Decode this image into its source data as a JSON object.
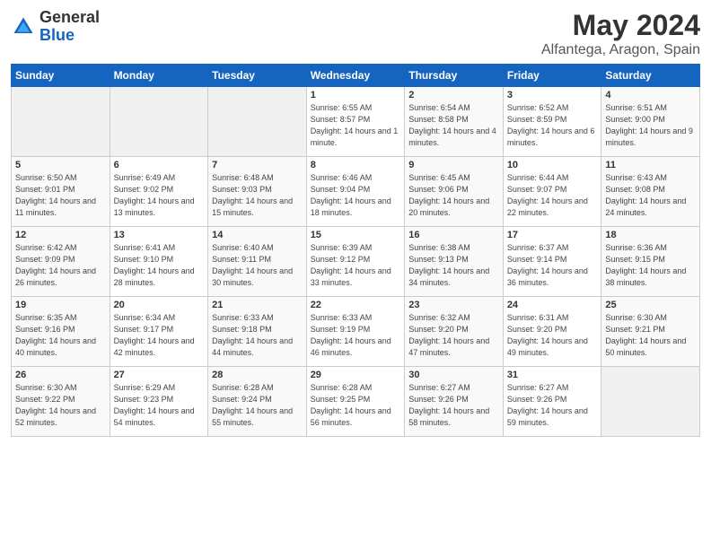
{
  "logo": {
    "general": "General",
    "blue": "Blue"
  },
  "header": {
    "month": "May 2024",
    "location": "Alfantega, Aragon, Spain"
  },
  "days_of_week": [
    "Sunday",
    "Monday",
    "Tuesday",
    "Wednesday",
    "Thursday",
    "Friday",
    "Saturday"
  ],
  "weeks": [
    [
      {
        "day": "",
        "sunrise": "",
        "sunset": "",
        "daylight": "",
        "empty": true
      },
      {
        "day": "",
        "sunrise": "",
        "sunset": "",
        "daylight": "",
        "empty": true
      },
      {
        "day": "",
        "sunrise": "",
        "sunset": "",
        "daylight": "",
        "empty": true
      },
      {
        "day": "1",
        "sunrise": "Sunrise: 6:55 AM",
        "sunset": "Sunset: 8:57 PM",
        "daylight": "Daylight: 14 hours and 1 minute."
      },
      {
        "day": "2",
        "sunrise": "Sunrise: 6:54 AM",
        "sunset": "Sunset: 8:58 PM",
        "daylight": "Daylight: 14 hours and 4 minutes."
      },
      {
        "day": "3",
        "sunrise": "Sunrise: 6:52 AM",
        "sunset": "Sunset: 8:59 PM",
        "daylight": "Daylight: 14 hours and 6 minutes."
      },
      {
        "day": "4",
        "sunrise": "Sunrise: 6:51 AM",
        "sunset": "Sunset: 9:00 PM",
        "daylight": "Daylight: 14 hours and 9 minutes."
      }
    ],
    [
      {
        "day": "5",
        "sunrise": "Sunrise: 6:50 AM",
        "sunset": "Sunset: 9:01 PM",
        "daylight": "Daylight: 14 hours and 11 minutes."
      },
      {
        "day": "6",
        "sunrise": "Sunrise: 6:49 AM",
        "sunset": "Sunset: 9:02 PM",
        "daylight": "Daylight: 14 hours and 13 minutes."
      },
      {
        "day": "7",
        "sunrise": "Sunrise: 6:48 AM",
        "sunset": "Sunset: 9:03 PM",
        "daylight": "Daylight: 14 hours and 15 minutes."
      },
      {
        "day": "8",
        "sunrise": "Sunrise: 6:46 AM",
        "sunset": "Sunset: 9:04 PM",
        "daylight": "Daylight: 14 hours and 18 minutes."
      },
      {
        "day": "9",
        "sunrise": "Sunrise: 6:45 AM",
        "sunset": "Sunset: 9:06 PM",
        "daylight": "Daylight: 14 hours and 20 minutes."
      },
      {
        "day": "10",
        "sunrise": "Sunrise: 6:44 AM",
        "sunset": "Sunset: 9:07 PM",
        "daylight": "Daylight: 14 hours and 22 minutes."
      },
      {
        "day": "11",
        "sunrise": "Sunrise: 6:43 AM",
        "sunset": "Sunset: 9:08 PM",
        "daylight": "Daylight: 14 hours and 24 minutes."
      }
    ],
    [
      {
        "day": "12",
        "sunrise": "Sunrise: 6:42 AM",
        "sunset": "Sunset: 9:09 PM",
        "daylight": "Daylight: 14 hours and 26 minutes."
      },
      {
        "day": "13",
        "sunrise": "Sunrise: 6:41 AM",
        "sunset": "Sunset: 9:10 PM",
        "daylight": "Daylight: 14 hours and 28 minutes."
      },
      {
        "day": "14",
        "sunrise": "Sunrise: 6:40 AM",
        "sunset": "Sunset: 9:11 PM",
        "daylight": "Daylight: 14 hours and 30 minutes."
      },
      {
        "day": "15",
        "sunrise": "Sunrise: 6:39 AM",
        "sunset": "Sunset: 9:12 PM",
        "daylight": "Daylight: 14 hours and 33 minutes."
      },
      {
        "day": "16",
        "sunrise": "Sunrise: 6:38 AM",
        "sunset": "Sunset: 9:13 PM",
        "daylight": "Daylight: 14 hours and 34 minutes."
      },
      {
        "day": "17",
        "sunrise": "Sunrise: 6:37 AM",
        "sunset": "Sunset: 9:14 PM",
        "daylight": "Daylight: 14 hours and 36 minutes."
      },
      {
        "day": "18",
        "sunrise": "Sunrise: 6:36 AM",
        "sunset": "Sunset: 9:15 PM",
        "daylight": "Daylight: 14 hours and 38 minutes."
      }
    ],
    [
      {
        "day": "19",
        "sunrise": "Sunrise: 6:35 AM",
        "sunset": "Sunset: 9:16 PM",
        "daylight": "Daylight: 14 hours and 40 minutes."
      },
      {
        "day": "20",
        "sunrise": "Sunrise: 6:34 AM",
        "sunset": "Sunset: 9:17 PM",
        "daylight": "Daylight: 14 hours and 42 minutes."
      },
      {
        "day": "21",
        "sunrise": "Sunrise: 6:33 AM",
        "sunset": "Sunset: 9:18 PM",
        "daylight": "Daylight: 14 hours and 44 minutes."
      },
      {
        "day": "22",
        "sunrise": "Sunrise: 6:33 AM",
        "sunset": "Sunset: 9:19 PM",
        "daylight": "Daylight: 14 hours and 46 minutes."
      },
      {
        "day": "23",
        "sunrise": "Sunrise: 6:32 AM",
        "sunset": "Sunset: 9:20 PM",
        "daylight": "Daylight: 14 hours and 47 minutes."
      },
      {
        "day": "24",
        "sunrise": "Sunrise: 6:31 AM",
        "sunset": "Sunset: 9:20 PM",
        "daylight": "Daylight: 14 hours and 49 minutes."
      },
      {
        "day": "25",
        "sunrise": "Sunrise: 6:30 AM",
        "sunset": "Sunset: 9:21 PM",
        "daylight": "Daylight: 14 hours and 50 minutes."
      }
    ],
    [
      {
        "day": "26",
        "sunrise": "Sunrise: 6:30 AM",
        "sunset": "Sunset: 9:22 PM",
        "daylight": "Daylight: 14 hours and 52 minutes."
      },
      {
        "day": "27",
        "sunrise": "Sunrise: 6:29 AM",
        "sunset": "Sunset: 9:23 PM",
        "daylight": "Daylight: 14 hours and 54 minutes."
      },
      {
        "day": "28",
        "sunrise": "Sunrise: 6:28 AM",
        "sunset": "Sunset: 9:24 PM",
        "daylight": "Daylight: 14 hours and 55 minutes."
      },
      {
        "day": "29",
        "sunrise": "Sunrise: 6:28 AM",
        "sunset": "Sunset: 9:25 PM",
        "daylight": "Daylight: 14 hours and 56 minutes."
      },
      {
        "day": "30",
        "sunrise": "Sunrise: 6:27 AM",
        "sunset": "Sunset: 9:26 PM",
        "daylight": "Daylight: 14 hours and 58 minutes."
      },
      {
        "day": "31",
        "sunrise": "Sunrise: 6:27 AM",
        "sunset": "Sunset: 9:26 PM",
        "daylight": "Daylight: 14 hours and 59 minutes."
      },
      {
        "day": "",
        "sunrise": "",
        "sunset": "",
        "daylight": "",
        "empty": true
      }
    ]
  ]
}
